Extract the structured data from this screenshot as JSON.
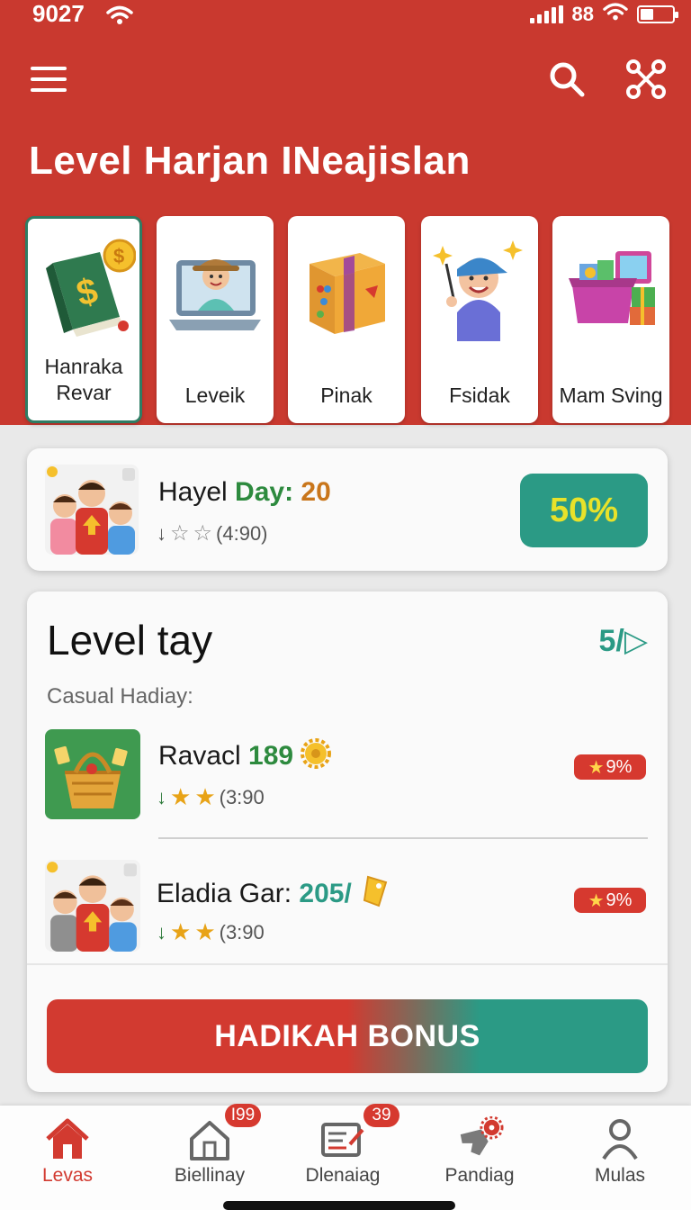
{
  "status_bar": {
    "time": "9027",
    "network": "88"
  },
  "header": {
    "title": "Level Harjan INeajislan"
  },
  "categories": [
    {
      "label": "Hanraka Revar",
      "icon": "book-coin-icon"
    },
    {
      "label": "Leveik",
      "icon": "laptop-person-icon"
    },
    {
      "label": "Pinak",
      "icon": "box-icon"
    },
    {
      "label": "Fsidak",
      "icon": "boy-sparkle-icon"
    },
    {
      "label": "Mam Sving",
      "icon": "gift-basket-icon"
    }
  ],
  "featured": {
    "name": "Hayel",
    "day_label": "Day:",
    "day_value": "20",
    "rating_text": "(4:90)",
    "discount": "50%"
  },
  "level_section": {
    "title": "Level tay",
    "count": "5/▷",
    "subtitle": "Casual Hadiay:",
    "items": [
      {
        "name": "Ravacl",
        "value": "189",
        "rating_text": "(3:90",
        "badge": "9%"
      },
      {
        "name": "Eladia Gar:",
        "value": "205/",
        "rating_text": "(3:90",
        "badge": "9%"
      }
    ],
    "bonus_button": "HADIKAH BONUS"
  },
  "bottom_nav": [
    {
      "label": "Levas",
      "icon": "home-icon",
      "active": true,
      "badge": ""
    },
    {
      "label": "Biellinay",
      "icon": "house-outline-icon",
      "active": false,
      "badge": "I99"
    },
    {
      "label": "Dlenaiag",
      "icon": "list-edit-icon",
      "active": false,
      "badge": "39"
    },
    {
      "label": "Pandiag",
      "icon": "puzzle-gear-icon",
      "active": false,
      "badge": ""
    },
    {
      "label": "Mulas",
      "icon": "person-icon",
      "active": false,
      "badge": ""
    }
  ],
  "colors": {
    "primary_red": "#c9392f",
    "teal": "#2b9a85",
    "green_text": "#2d8a3e",
    "orange_text": "#c9761b"
  }
}
